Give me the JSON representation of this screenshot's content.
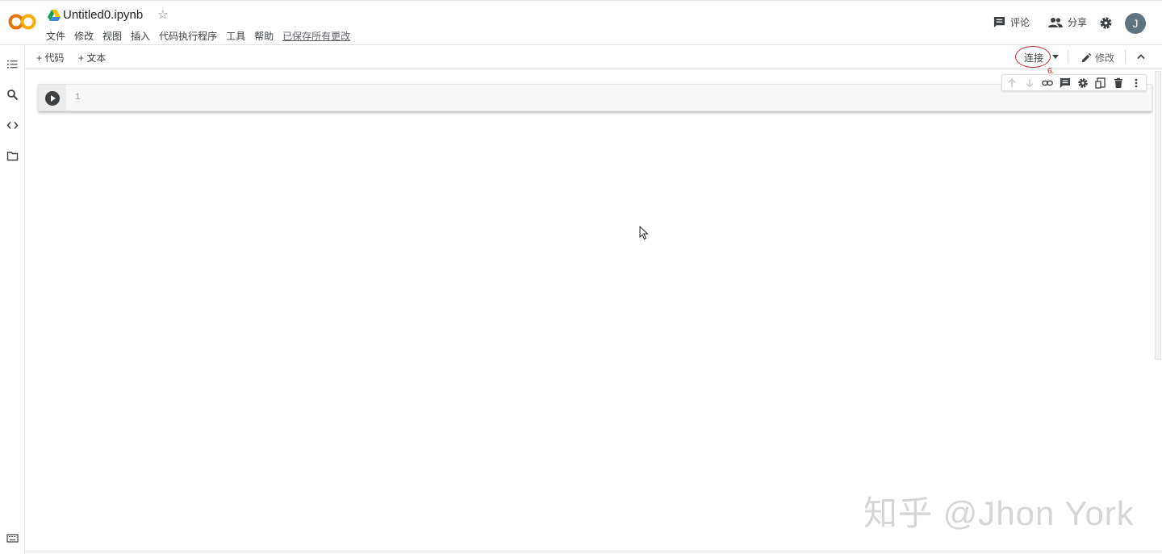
{
  "header": {
    "title": "Untitled0.ipynb",
    "menu": [
      "文件",
      "修改",
      "视图",
      "插入",
      "代码执行程序",
      "工具",
      "帮助"
    ],
    "saved_status": "已保存所有更改",
    "comment_label": "评论",
    "share_label": "分享",
    "avatar_letter": "J"
  },
  "toolbar": {
    "add_code": "+ 代码",
    "add_text": "+ 文本",
    "connect": "连接",
    "annotation": "6.",
    "edit": "修改"
  },
  "cell": {
    "line_number": "1"
  },
  "watermark": "知乎 @Jhon York",
  "colors": {
    "logo_orange": "#f9ab00",
    "logo_dark_orange": "#e8710a",
    "annotation_red": "#c62828",
    "avatar": "#5f7480"
  },
  "icons": [
    "colab-logo",
    "drive-icon",
    "star-icon",
    "comment-icon",
    "people-icon",
    "gear-icon",
    "toc-icon",
    "search-icon",
    "code-icon",
    "folder-icon",
    "terminal-icon",
    "pencil-icon",
    "chevron-up-icon",
    "arrow-up-icon",
    "arrow-down-icon",
    "link-icon",
    "cell-comment-icon",
    "cell-settings-icon",
    "mirror-cell-icon",
    "delete-icon",
    "more-vert-icon",
    "play-icon"
  ]
}
